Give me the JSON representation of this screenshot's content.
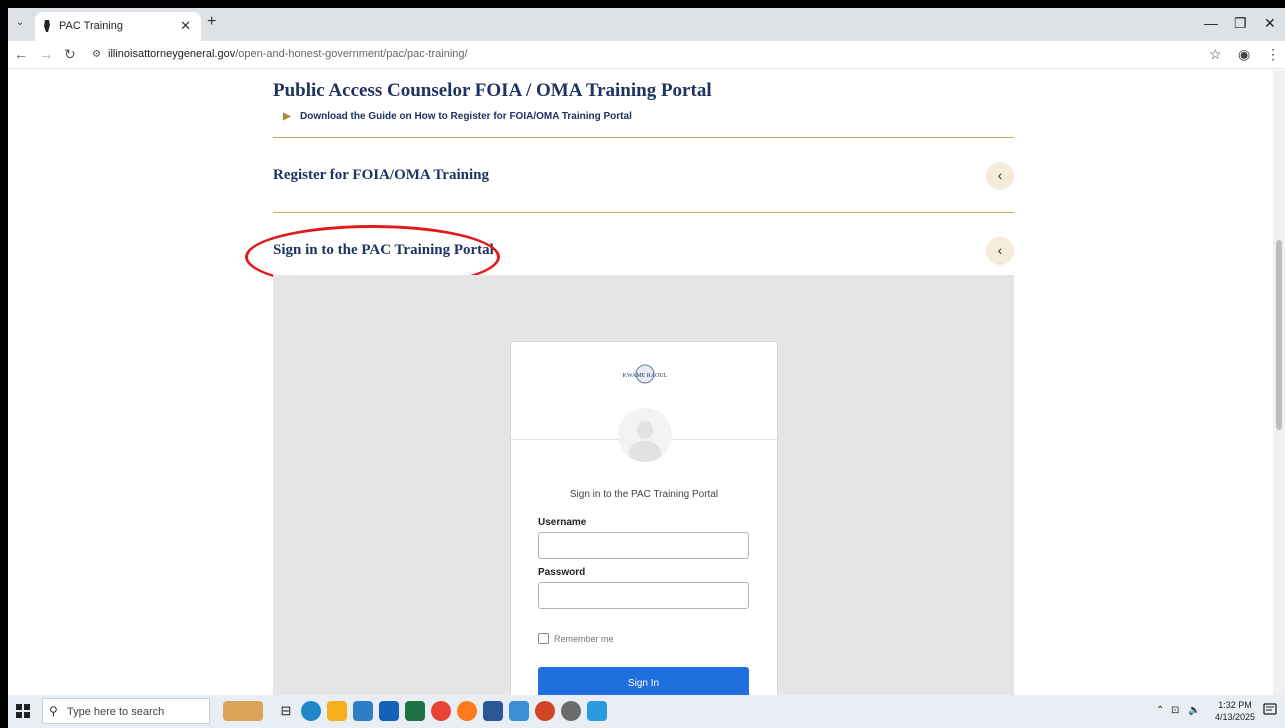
{
  "browser": {
    "tab_title": "PAC Training",
    "url_domain": "illinoisattorneygeneral.gov",
    "url_path": "/open-and-honest-government/pac/pac-training/"
  },
  "page": {
    "section_title": "Public Access Counselor FOIA / OMA Training Portal",
    "guide_link": "Download the Guide on How to Register for FOIA/OMA Training Portal",
    "accordion": [
      {
        "title": "Register for FOIA/OMA Training",
        "icon": "chevron-left-icon"
      },
      {
        "title": "Sign in to the PAC Training Portal",
        "icon": "chevron-left-icon"
      }
    ],
    "highlight_color": "#e01b1b",
    "accent_color": "#1d3361",
    "divider_color": "#c9a86b"
  },
  "login": {
    "logo_text": "KWAME RAOUL",
    "heading": "Sign in to the PAC Training Portal",
    "username_label": "Username",
    "username_value": "",
    "password_label": "Password",
    "password_value": "",
    "remember_label": "Remember me",
    "remember_checked": false,
    "signin_label": "Sign In",
    "button_color": "#1f6fde"
  },
  "taskbar": {
    "search_placeholder": "Type here to search",
    "time": "1:32 PM",
    "date": "4/13/2025"
  }
}
